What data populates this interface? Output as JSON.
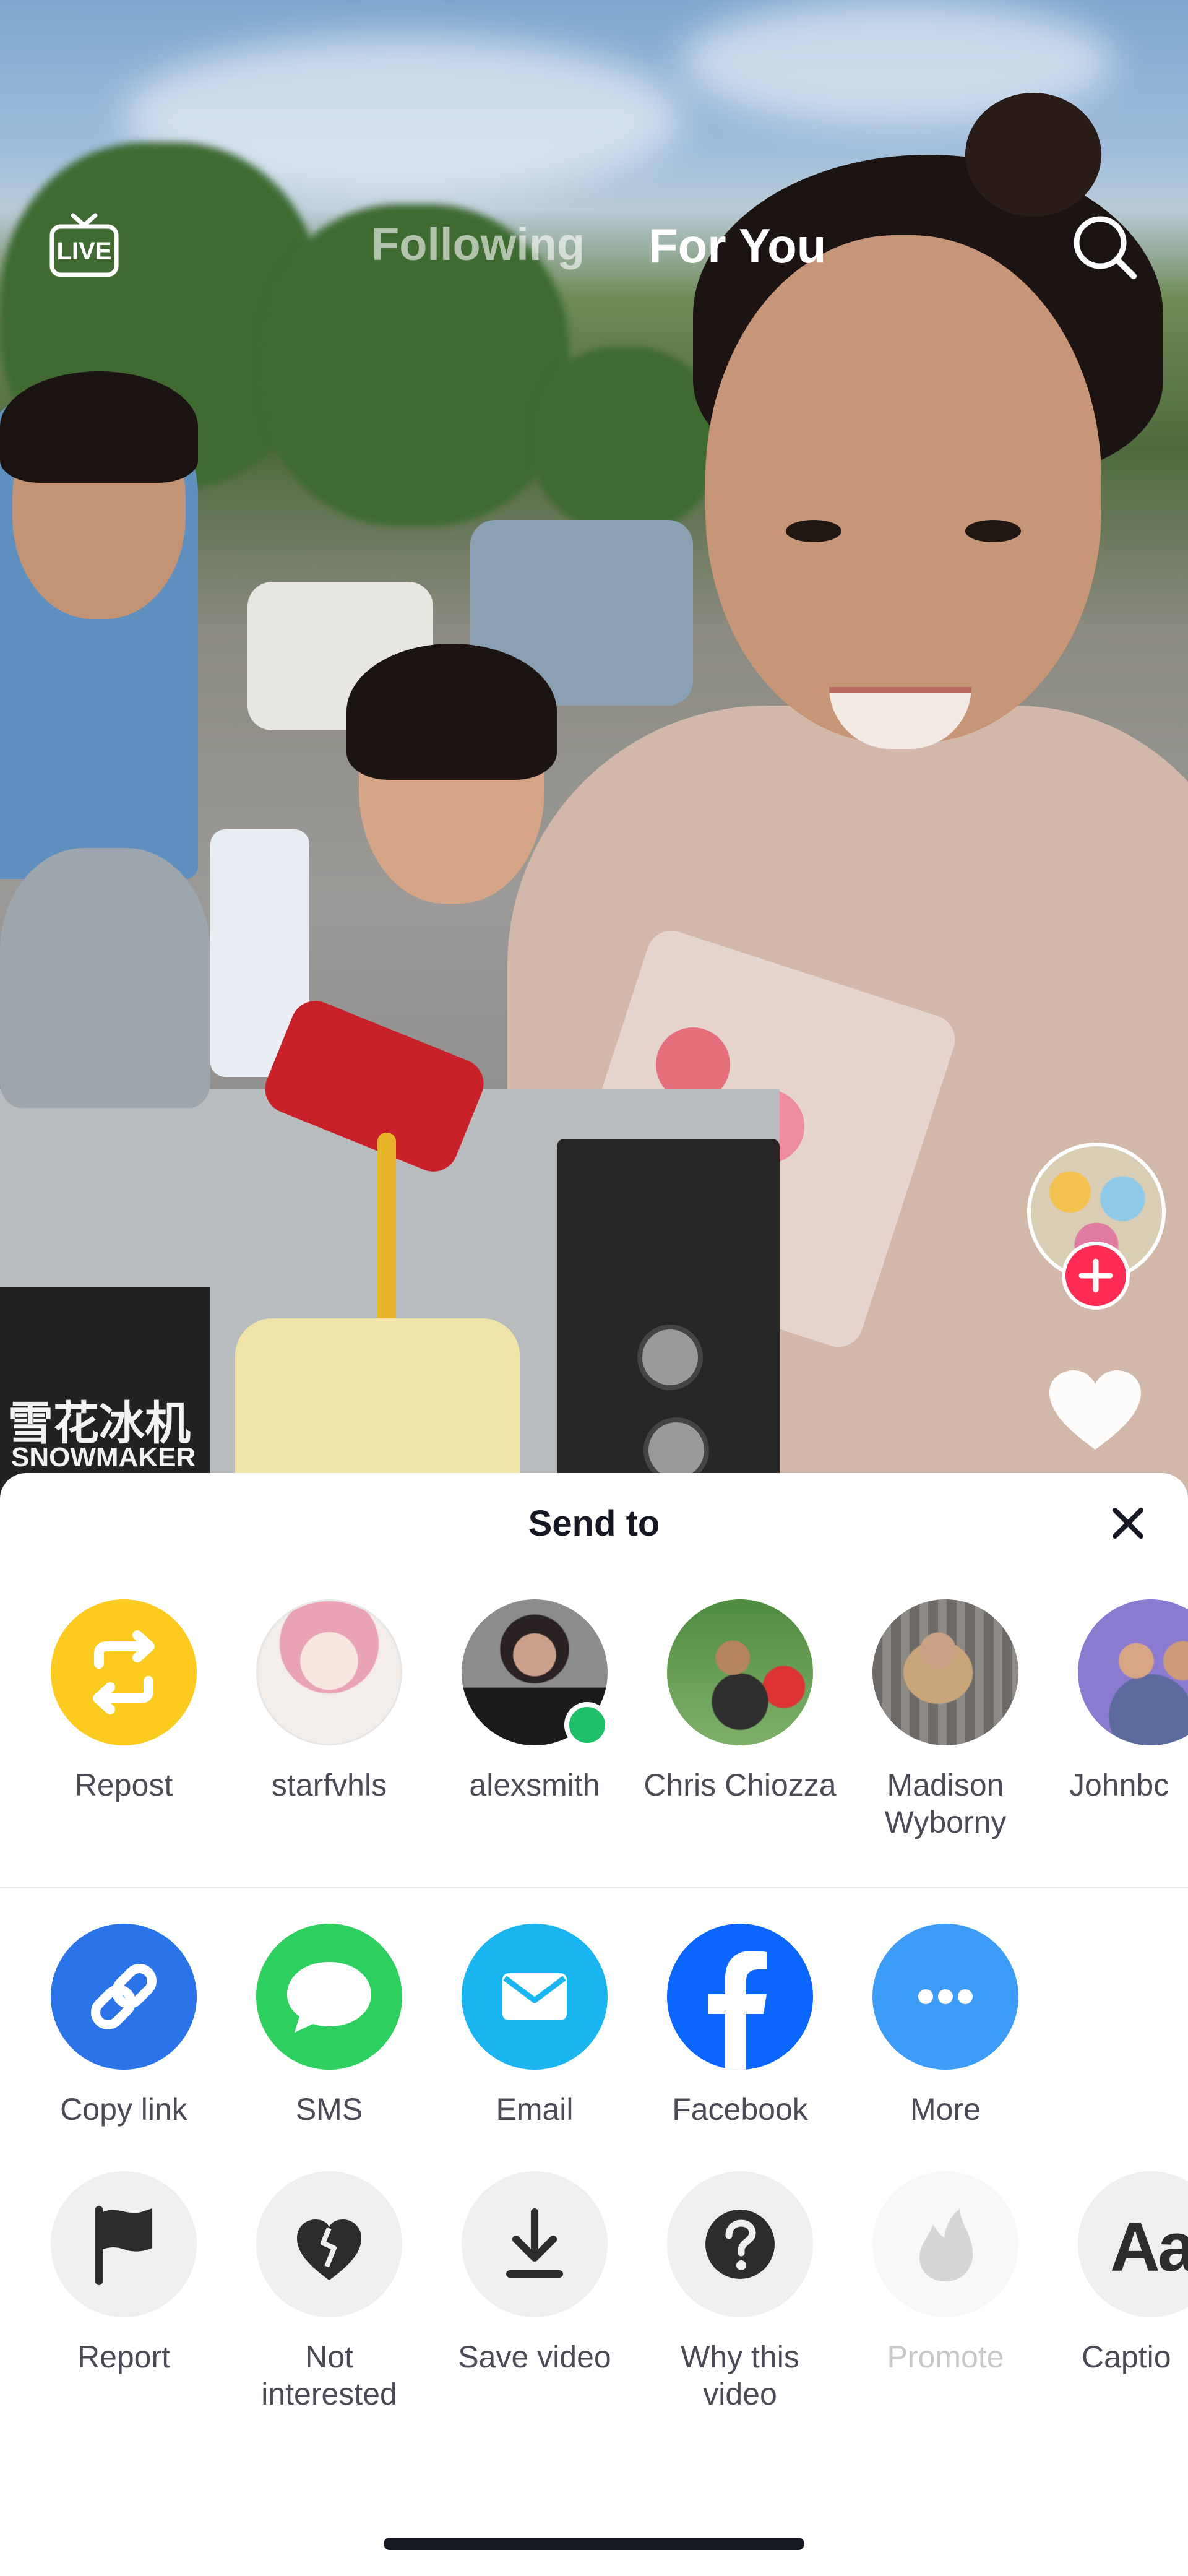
{
  "top_nav": {
    "live_label": "LIVE",
    "following_label": "Following",
    "for_you_label": "For You"
  },
  "video_text": {
    "machine_cn": "雪花冰机",
    "machine_en": "SNOWMAKER"
  },
  "share_sheet": {
    "title": "Send to",
    "contacts": [
      {
        "label": "Repost",
        "icon": "repost-icon",
        "color": "#fdcb1f"
      },
      {
        "label": "starfvhls"
      },
      {
        "label": "alexsmith",
        "online": true
      },
      {
        "label": "Chris Chiozza"
      },
      {
        "label": "Madison Wyborny"
      },
      {
        "label": "Johnbc"
      }
    ],
    "share_apps": [
      {
        "label": "Copy link",
        "icon": "link-icon",
        "color": "#2a73e8"
      },
      {
        "label": "SMS",
        "icon": "sms-icon",
        "color": "#2dd05f"
      },
      {
        "label": "Email",
        "icon": "email-icon",
        "color": "#19b5f0"
      },
      {
        "label": "Facebook",
        "icon": "facebook-icon",
        "color": "#0a66ff"
      },
      {
        "label": "More",
        "icon": "more-icon",
        "color": "#3c9cf7"
      }
    ],
    "actions": [
      {
        "label": "Report",
        "icon": "flag-icon"
      },
      {
        "label": "Not interested",
        "icon": "broken-heart-icon"
      },
      {
        "label": "Save video",
        "icon": "download-icon"
      },
      {
        "label": "Why this video",
        "icon": "question-icon"
      },
      {
        "label": "Promote",
        "icon": "flame-icon",
        "disabled": true
      },
      {
        "label": "Captio",
        "icon": "captions-icon"
      }
    ]
  }
}
